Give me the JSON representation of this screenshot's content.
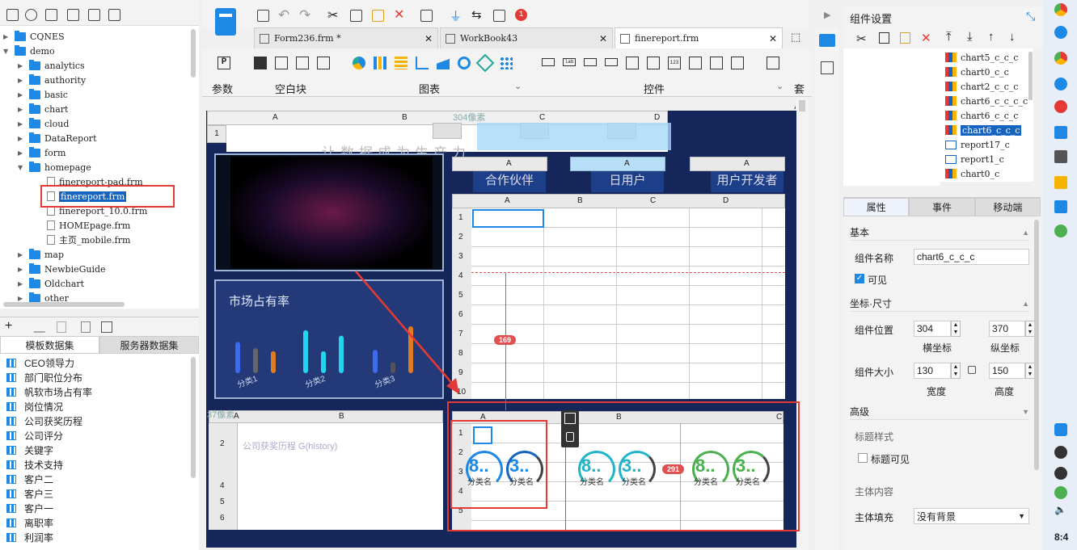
{
  "left_panel": {
    "tree": [
      {
        "label": "CQNES",
        "type": "folder",
        "state": "collapsed",
        "indent": 0
      },
      {
        "label": "demo",
        "type": "folder",
        "state": "expanded",
        "indent": 0
      },
      {
        "label": "analytics",
        "type": "folder",
        "state": "collapsed",
        "indent": 1
      },
      {
        "label": "authority",
        "type": "folder",
        "state": "collapsed",
        "indent": 1
      },
      {
        "label": "basic",
        "type": "folder",
        "state": "collapsed",
        "indent": 1
      },
      {
        "label": "chart",
        "type": "folder",
        "state": "collapsed",
        "indent": 1
      },
      {
        "label": "cloud",
        "type": "folder",
        "state": "collapsed",
        "indent": 1
      },
      {
        "label": "DataReport",
        "type": "folder",
        "state": "collapsed",
        "indent": 1
      },
      {
        "label": "form",
        "type": "folder",
        "state": "collapsed",
        "indent": 1
      },
      {
        "label": "homepage",
        "type": "folder",
        "state": "expanded",
        "indent": 1
      },
      {
        "label": "finereport-pad.frm",
        "type": "file",
        "indent": 2
      },
      {
        "label": "finereport.frm",
        "type": "file",
        "indent": 2,
        "selected": true
      },
      {
        "label": "finereport_10.0.frm",
        "type": "file",
        "indent": 2
      },
      {
        "label": "HOMEpage.frm",
        "type": "file",
        "indent": 2
      },
      {
        "label": "主页_mobile.frm",
        "type": "file",
        "indent": 2
      },
      {
        "label": "map",
        "type": "folder",
        "state": "collapsed",
        "indent": 1
      },
      {
        "label": "NewbieGuide",
        "type": "folder",
        "state": "collapsed",
        "indent": 1
      },
      {
        "label": "Oldchart",
        "type": "folder",
        "state": "collapsed",
        "indent": 1
      },
      {
        "label": "other",
        "type": "folder",
        "state": "collapsed",
        "indent": 1
      }
    ],
    "dataset_tabs": [
      "模板数据集",
      "服务器数据集"
    ],
    "datasets": [
      "CEO领导力",
      "部门职位分布",
      "帆软市场占有率",
      "岗位情况",
      "公司获奖历程",
      "公司评分",
      "关键字",
      "技术支持",
      "客户二",
      "客户三",
      "客户一",
      "离职率",
      "利润率"
    ]
  },
  "center": {
    "file_tabs": [
      {
        "label": "Form236.frm *",
        "active": false
      },
      {
        "label": "WorkBook43",
        "active": false
      },
      {
        "label": "finereport.frm",
        "active": true
      }
    ],
    "notif_count": "1",
    "ribbon_labels": {
      "param": "参数",
      "block": "空白块",
      "chart": "图表",
      "widget": "控件",
      "set": "套用"
    },
    "canvas": {
      "pixel_label_top": "304像素",
      "pixel_label_left": "37像素",
      "col_letters": [
        "A",
        "B",
        "C",
        "D"
      ],
      "widget_headers": [
        "合作伙伴",
        "日用户",
        "用户开发者"
      ],
      "market_title": "市场占有率",
      "bar_categories": [
        "分类1",
        "分类2",
        "分类3"
      ],
      "bar_series": [
        {
          "color": "#3d6bf0",
          "values": [
            40,
            15
          ]
        },
        {
          "color": "#23d5f0",
          "values": [
            55,
            30,
            50
          ]
        },
        {
          "color": "#e07b1f",
          "values": [
            30,
            60
          ]
        }
      ],
      "history_label": "公司获奖历程 G(history)",
      "distance_v": "169",
      "distance_h": "291",
      "row_nums": [
        "1",
        "2",
        "3",
        "4",
        "5",
        "6",
        "7",
        "8",
        "9",
        "10"
      ],
      "gauge_prefix1": "8..",
      "gauge_prefix2": "3..",
      "gauge_sub": "分类名",
      "header_text_fade": "让数据成为生产力"
    }
  },
  "right_panel": {
    "title": "组件设置",
    "components": [
      {
        "label": "chart5_c_c_c",
        "type": "chart"
      },
      {
        "label": "chart0_c_c",
        "type": "chart"
      },
      {
        "label": "chart2_c_c_c",
        "type": "chart"
      },
      {
        "label": "chart6_c_c_c_c",
        "type": "chart"
      },
      {
        "label": "chart6_c_c_c",
        "type": "chart"
      },
      {
        "label": "chart6_c_c_c",
        "type": "chart",
        "selected": true
      },
      {
        "label": "report17_c",
        "type": "report"
      },
      {
        "label": "report1_c",
        "type": "report"
      },
      {
        "label": "chart0_c",
        "type": "chart"
      }
    ],
    "tabs": [
      "属性",
      "事件",
      "移动端"
    ],
    "basic_section": "基本",
    "name_label": "组件名称",
    "name_value": "chart6_c_c_c",
    "visible_label": "可见",
    "coord_section": "坐标·尺寸",
    "pos_label": "组件位置",
    "pos_x": "304",
    "pos_y": "370",
    "x_caption": "横坐标",
    "y_caption": "纵坐标",
    "size_label": "组件大小",
    "width": "130",
    "height": "150",
    "w_caption": "宽度",
    "h_caption": "高度",
    "adv_section": "高级",
    "title_style": "标题样式",
    "title_visible": "标题可见",
    "body_content": "主体内容",
    "body_fill": "主体填充",
    "fill_value": "没有背景"
  },
  "taskbar": {
    "time": "8:4"
  }
}
